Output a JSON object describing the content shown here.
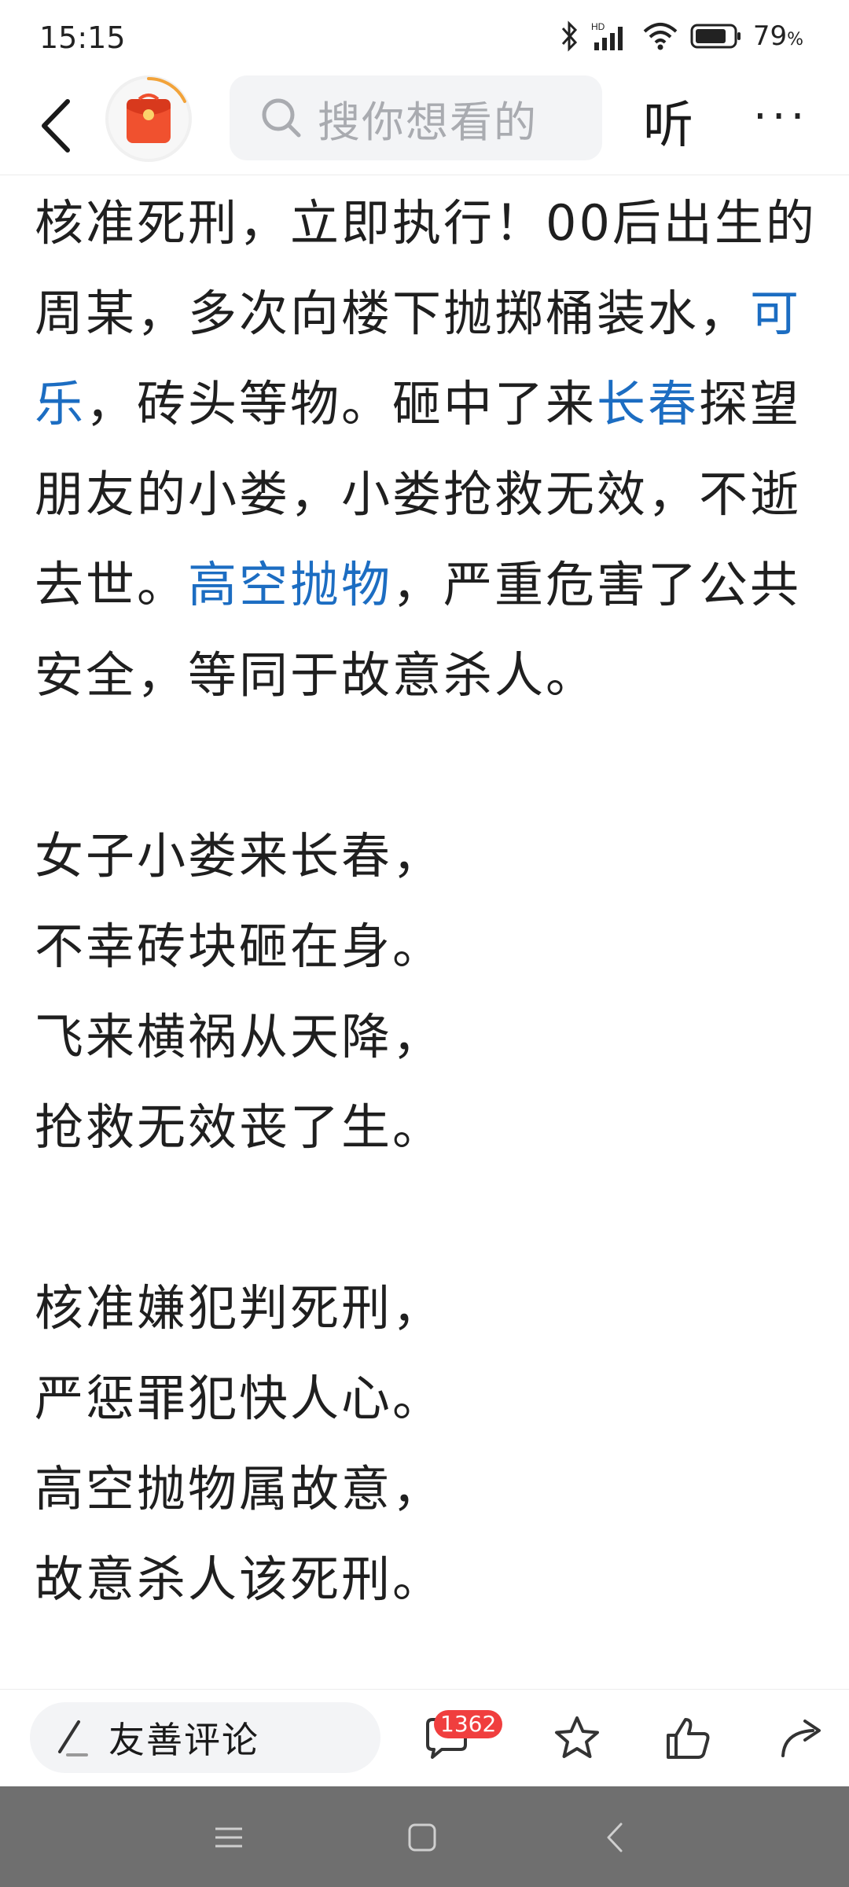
{
  "status_bar": {
    "time": "15:15",
    "battery": "79",
    "battery_unit": "%"
  },
  "header": {
    "search_placeholder": "搜你想看的",
    "listen_label": "听",
    "more_label": "···"
  },
  "article": {
    "paragraph1": {
      "part1": "核准死刑，立即执行！00后出生的周某，多次向楼下抛掷桶装水，",
      "link1": "可乐",
      "part2": "，砖头等物。砸中了来",
      "link2": "长春",
      "part3": "探望朋友的小娄，小娄抢救无效，不逝去世。",
      "link3": "高空抛物",
      "part4": "，严重危害了公共安全，等同于故意杀人。"
    },
    "poem1": [
      "女子小娄来长春，",
      "不幸砖块砸在身。",
      "飞来横祸从天降，",
      "抢救无效丧了生。"
    ],
    "poem2": [
      "核准嫌犯判死刑，",
      "严惩罪犯快人心。",
      "高空抛物属故意，",
      "故意杀人该死刑。"
    ]
  },
  "action_bar": {
    "comment_placeholder": "友善评论",
    "comment_count": "1362"
  },
  "icons": {
    "back": "back-arrow-icon",
    "avatar": "red-envelope-icon",
    "search": "search-icon",
    "pen": "pen-icon",
    "comment": "comment-bubble-icon",
    "star": "star-icon",
    "like": "thumbs-up-icon",
    "share": "share-arrow-icon"
  },
  "colors": {
    "link": "#1c6dc2",
    "badge": "#f03e3e",
    "nav_bar": "#6f6f6f"
  }
}
